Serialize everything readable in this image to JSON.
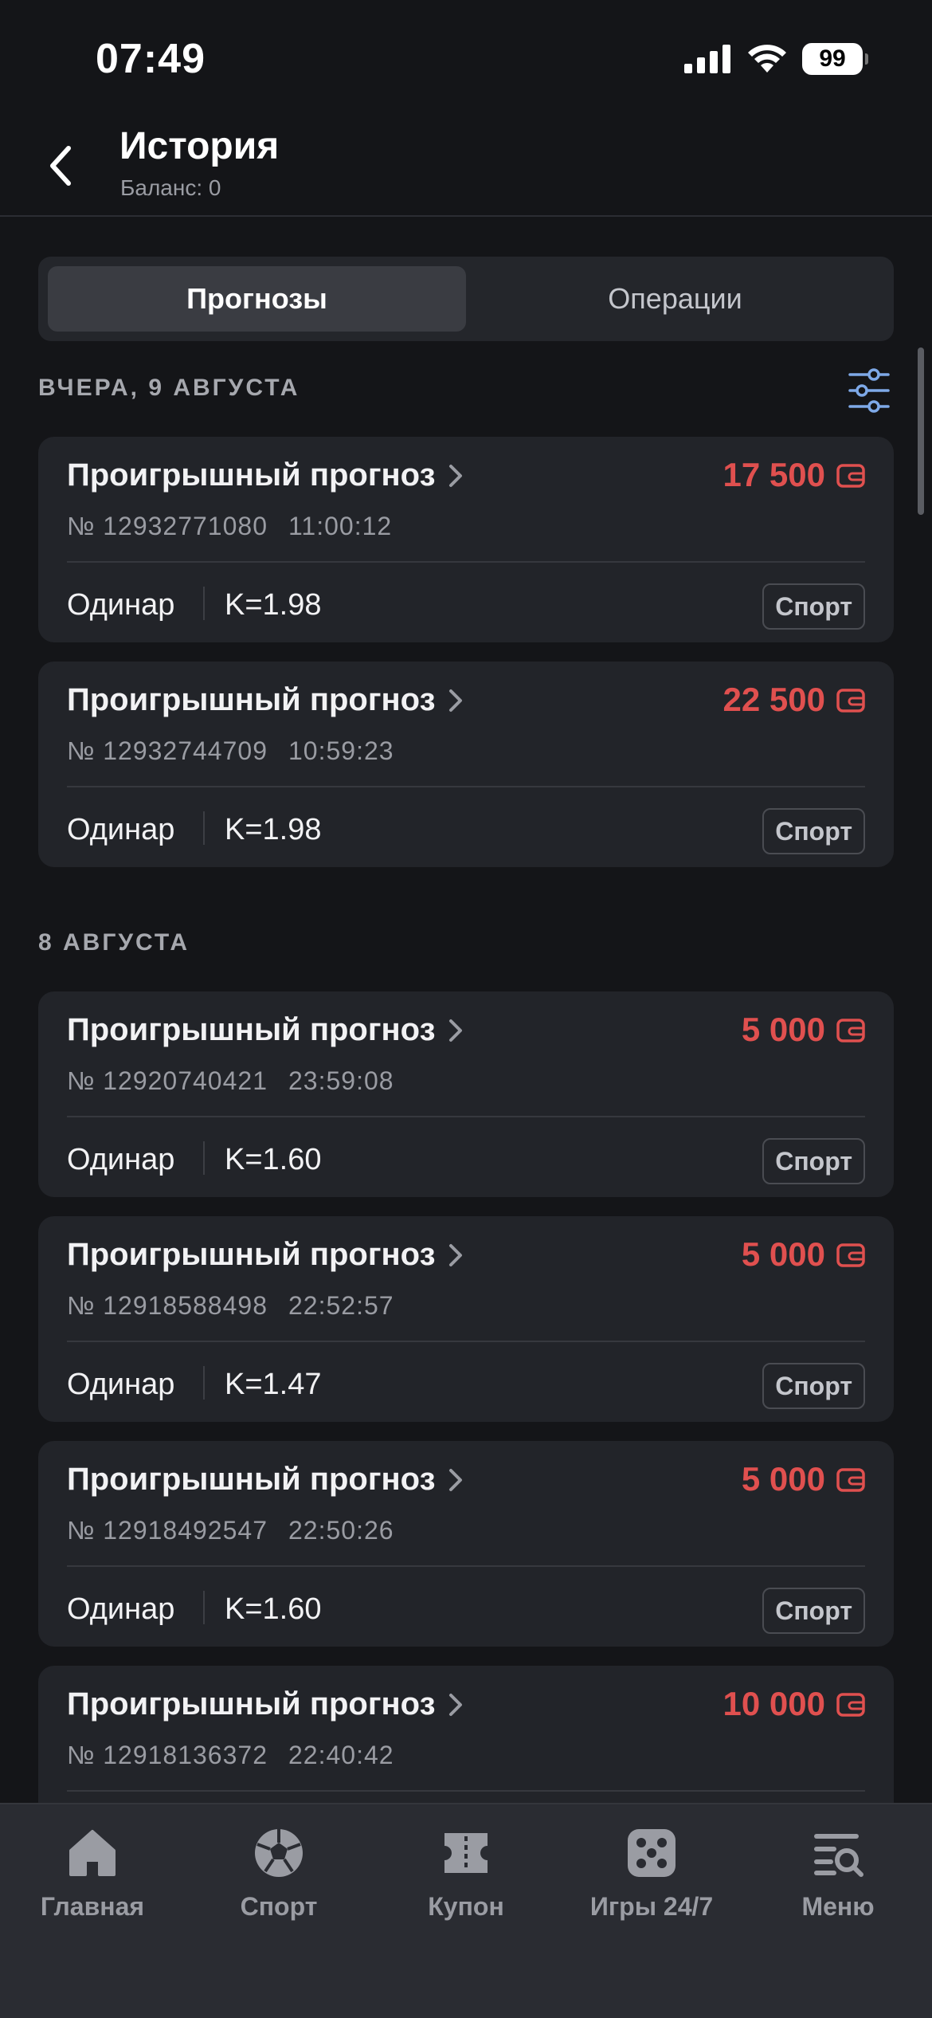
{
  "status_bar": {
    "time": "07:49",
    "battery": "99"
  },
  "header": {
    "title": "История",
    "balance": "Баланс: 0"
  },
  "tabs": [
    {
      "label": "Прогнозы",
      "active": true
    },
    {
      "label": "Операции",
      "active": false
    }
  ],
  "sections": [
    {
      "title": "ВЧЕРА, 9 АВГУСТА",
      "cards": [
        {
          "title": "Проигрышный прогноз",
          "amount": "17 500",
          "number": "№ 12932771080",
          "time": "11:00:12",
          "type": "Одинар",
          "odds": "K=1.98",
          "tag": "Спорт"
        },
        {
          "title": "Проигрышный прогноз",
          "amount": "22 500",
          "number": "№ 12932744709",
          "time": "10:59:23",
          "type": "Одинар",
          "odds": "K=1.98",
          "tag": "Спорт"
        }
      ]
    },
    {
      "title": "8 АВГУСТА",
      "cards": [
        {
          "title": "Проигрышный прогноз",
          "amount": "5 000",
          "number": "№ 12920740421",
          "time": "23:59:08",
          "type": "Одинар",
          "odds": "K=1.60",
          "tag": "Спорт"
        },
        {
          "title": "Проигрышный прогноз",
          "amount": "5 000",
          "number": "№ 12918588498",
          "time": "22:52:57",
          "type": "Одинар",
          "odds": "K=1.47",
          "tag": "Спорт"
        },
        {
          "title": "Проигрышный прогноз",
          "amount": "5 000",
          "number": "№ 12918492547",
          "time": "22:50:26",
          "type": "Одинар",
          "odds": "K=1.60",
          "tag": "Спорт"
        },
        {
          "title": "Проигрышный прогноз",
          "amount": "10 000",
          "number": "№ 12918136372",
          "time": "22:40:42"
        }
      ]
    }
  ],
  "bottom_nav": [
    {
      "label": "Главная",
      "icon": "home-icon"
    },
    {
      "label": "Спорт",
      "icon": "soccer-ball-icon"
    },
    {
      "label": "Купон",
      "icon": "ticket-icon"
    },
    {
      "label": "Игры 24/7",
      "icon": "dice-icon"
    },
    {
      "label": "Меню",
      "icon": "menu-search-icon"
    }
  ],
  "colors": {
    "background": "#141518",
    "card": "#222429",
    "loss_amount": "#e0504f",
    "nav_background": "#2a2c32"
  }
}
